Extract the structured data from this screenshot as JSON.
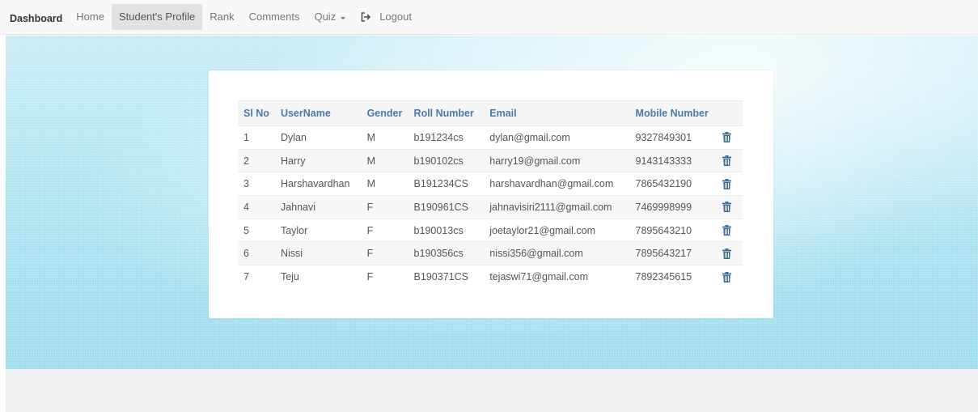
{
  "navbar": {
    "brand": "Dashboard",
    "items": [
      {
        "label": "Home"
      },
      {
        "label": "Student's Profile"
      },
      {
        "label": "Rank"
      },
      {
        "label": "Comments"
      },
      {
        "label": "Quiz"
      }
    ],
    "logout_label": "Logout",
    "logout_icon": "logout-icon"
  },
  "table": {
    "headers": [
      "Sl No",
      "UserName",
      "Gender",
      "Roll Number",
      "Email",
      "Mobile Number"
    ],
    "delete_icon": "trash-icon",
    "rows": [
      {
        "sl": "1",
        "username": "Dylan",
        "gender": "M",
        "roll": "b191234cs",
        "email": "dylan@gmail.com",
        "mobile": "9327849301"
      },
      {
        "sl": "2",
        "username": "Harry",
        "gender": "M",
        "roll": "b190102cs",
        "email": "harry19@gmail.com",
        "mobile": "9143143333"
      },
      {
        "sl": "3",
        "username": "Harshavardhan",
        "gender": "M",
        "roll": "B191234CS",
        "email": "harshavardhan@gmail.com",
        "mobile": "7865432190"
      },
      {
        "sl": "4",
        "username": "Jahnavi",
        "gender": "F",
        "roll": "B190961CS",
        "email": "jahnavisiri2111@gmail.com",
        "mobile": "7469998999"
      },
      {
        "sl": "5",
        "username": "Taylor",
        "gender": "F",
        "roll": "b190013cs",
        "email": "joetaylor21@gmail.com",
        "mobile": "7895643210"
      },
      {
        "sl": "6",
        "username": "Nissi",
        "gender": "F",
        "roll": "b190356cs",
        "email": "nissi356@gmail.com",
        "mobile": "7895643217"
      },
      {
        "sl": "7",
        "username": "Teju",
        "gender": "F",
        "roll": "B190371CS",
        "email": "tejaswi71@gmail.com",
        "mobile": "7892345615"
      }
    ]
  },
  "colors": {
    "header_text": "#4a7aa8",
    "icon": "#3a6a9a",
    "banner": "#a9e1f0"
  }
}
